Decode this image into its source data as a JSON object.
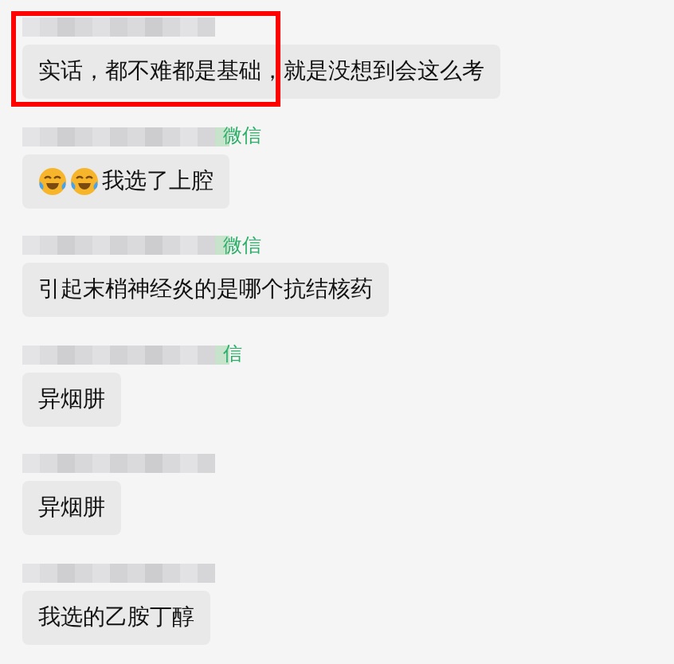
{
  "messages": [
    {
      "text": "实话，都不难都是基础，就是没想到会这么考",
      "highlighted": true
    },
    {
      "sender_suffix": "微信",
      "text": "我选了上腔",
      "highlighted": false,
      "emoji": [
        {
          "kind": "laughing-crying"
        },
        {
          "kind": "laughing-crying"
        }
      ]
    },
    {
      "sender_suffix": "微信",
      "text": "引起末梢神经炎的是哪个抗结核药",
      "highlighted": false
    },
    {
      "sender_suffix": "信",
      "text": "异烟肼",
      "highlighted": false
    },
    {
      "text": "异烟肼",
      "highlighted": false
    },
    {
      "text": "我选的乙胺丁醇",
      "highlighted": false
    }
  ]
}
